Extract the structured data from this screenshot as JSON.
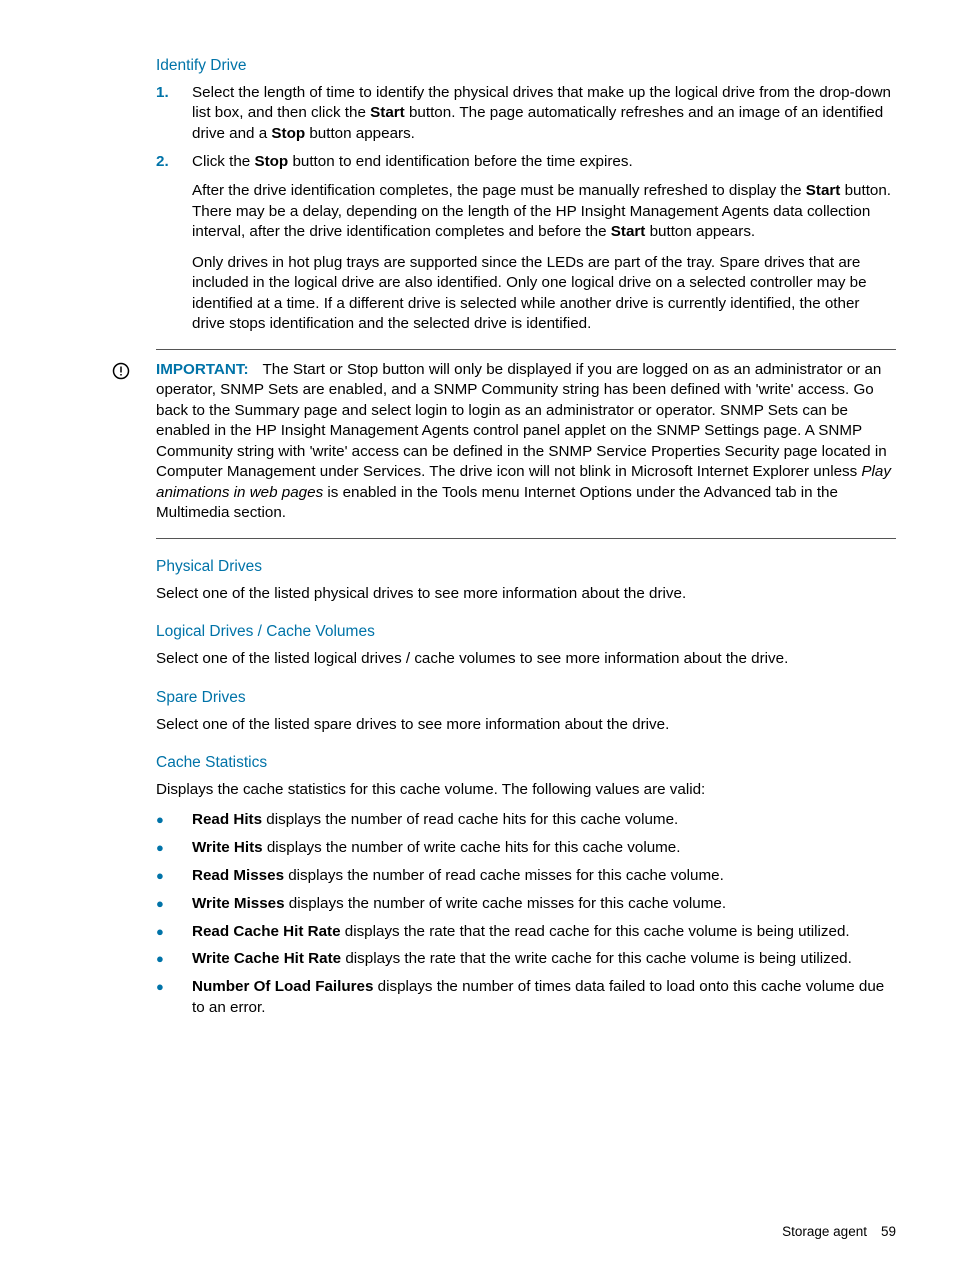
{
  "identify": {
    "title": "Identify Drive",
    "step1_a": "Select the length of time to identify the physical drives that make up the logical drive from the drop-down list box, and then click the ",
    "step1_b1": "Start",
    "step1_c": " button. The page automatically refreshes and an image of an identified drive and a ",
    "step1_b2": "Stop",
    "step1_d": " button appears.",
    "step2_a": "Click the ",
    "step2_b": "Stop",
    "step2_c": " button to end identification before the time expires.",
    "p3_a": "After the drive identification completes, the page must be manually refreshed to display the ",
    "p3_b1": "Start",
    "p3_c": " button. There may be a delay, depending on the length of the HP Insight Management Agents data collection interval, after the drive identification completes and before the ",
    "p3_b2": "Start",
    "p3_d": " button appears.",
    "p4": "Only drives in hot plug trays are supported since the LEDs are part of the tray. Spare drives that are included in the logical drive are also identified. Only one logical drive on a selected controller may be identified at a time. If a different drive is selected while another drive is currently identified, the other drive stops identification and the selected drive is identified."
  },
  "important": {
    "label": "IMPORTANT:",
    "text_a": "The Start or Stop button will only be displayed if you are logged on as an administrator or an operator, SNMP Sets are enabled, and a SNMP Community string has been defined with 'write' access. Go back to the Summary page and select login to login as an administrator or operator. SNMP Sets can be enabled in the HP Insight Management Agents control panel applet on the SNMP Settings page. A SNMP Community string with 'write' access can be defined in the SNMP Service Properties Security page located in Computer Management under Services. The drive icon will not blink in Microsoft Internet Explorer unless ",
    "text_i": "Play animations in web pages",
    "text_b": " is enabled in the Tools menu Internet Options under the Advanced tab in the Multimedia section."
  },
  "phys": {
    "title": "Physical Drives",
    "text": "Select one of the listed physical drives to see more information about the drive."
  },
  "log": {
    "title": "Logical Drives / Cache Volumes",
    "text": "Select one of the listed logical drives / cache volumes to see more information about the drive."
  },
  "spare": {
    "title": "Spare Drives",
    "text": "Select one of the listed spare drives to see more information about the drive."
  },
  "cache": {
    "title": "Cache Statistics",
    "intro": "Displays the cache statistics for this cache volume. The following values are valid:",
    "b1_term": "Read Hits",
    "b1_desc": " displays the number of read cache hits for this cache volume.",
    "b2_term": "Write Hits",
    "b2_desc": " displays the number of write cache hits for this cache volume.",
    "b3_term": "Read Misses",
    "b3_desc": " displays the number of read cache misses for this cache volume.",
    "b4_term": "Write Misses",
    "b4_desc": " displays the number of write cache misses for this cache volume.",
    "b5_term": "Read Cache Hit Rate",
    "b5_desc": " displays the rate that the read cache for this cache volume is being utilized.",
    "b6_term": "Write Cache Hit Rate",
    "b6_desc": " displays the rate that the write cache for this cache volume is being utilized.",
    "b7_term": "Number Of Load Failures",
    "b7_desc": " displays the number of times data failed to load onto this cache volume due to an error."
  },
  "footer": {
    "section": "Storage agent",
    "page": "59"
  }
}
